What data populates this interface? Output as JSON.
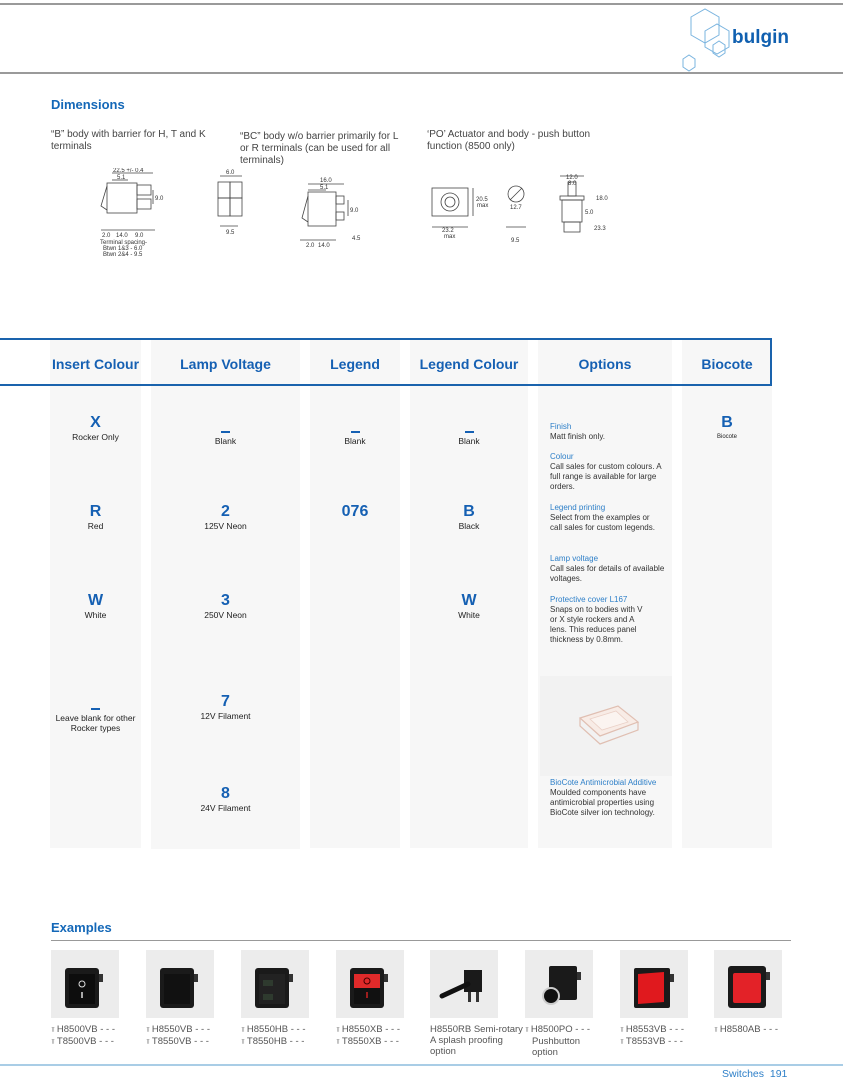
{
  "brand": {
    "name": "bulgin",
    "accent": "#1560b3",
    "light_accent": "#2d7fc8"
  },
  "dimensions": {
    "title": "Dimensions",
    "captions": [
      "“B” body with barrier for H, T and K terminals",
      "“BC” body w/o barrier primarily for L or R terminals (can be used for all terminals)",
      "‘PO’ Actuator and body - push button function (8500 only)"
    ],
    "b_body": {
      "overall": "22.5 +/- 0.4",
      "d1": "5.1",
      "d2": "9.0",
      "bottom": [
        "2.0",
        "14.0",
        "9.0"
      ],
      "spacing_title": "Terminal spacing-",
      "spacing_1": "Btwn 1&3 - 6.0",
      "spacing_2": "Btwn 2&4 - 9.5"
    },
    "end_view": {
      "top": "6.0",
      "bottom": "9.5"
    },
    "bc_body": {
      "overall": "16.0",
      "d1": "5.1",
      "d2": "9.0",
      "d3": "4.5",
      "bottom": [
        "2.0",
        "14.0"
      ]
    },
    "po": {
      "height": "20.5",
      "height_note": "max",
      "width": "23.2",
      "width_note": "max",
      "cutout_dia": "12.7",
      "flat": "9.5",
      "side_top": "12.0",
      "side_top2": "8.0",
      "side_h1": "18.0",
      "side_h2": "5.0",
      "side_h3": "23.3"
    }
  },
  "table": {
    "headers": [
      "Insert Colour",
      "Lamp Voltage",
      "Legend",
      "Legend Colour",
      "Options",
      "Biocote"
    ],
    "insert_colour": [
      {
        "code": "X",
        "desc": "Rocker Only"
      },
      {
        "code": "R",
        "desc": "Red"
      },
      {
        "code": "W",
        "desc": "White"
      },
      {
        "code": "_",
        "desc": "Leave blank for other Rocker types"
      }
    ],
    "lamp_voltage": [
      {
        "code": "_",
        "desc": "Blank"
      },
      {
        "code": "2",
        "desc": "125V Neon"
      },
      {
        "code": "3",
        "desc": "250V Neon"
      },
      {
        "code": "7",
        "desc": "12V Filament"
      },
      {
        "code": "8",
        "desc": "24V Filament"
      }
    ],
    "legend": [
      {
        "code": "_",
        "desc": "Blank"
      },
      {
        "code": "076",
        "desc": ""
      }
    ],
    "legend_colour": [
      {
        "code": "_",
        "desc": "Blank"
      },
      {
        "code": "B",
        "desc": "Black"
      },
      {
        "code": "W",
        "desc": "White"
      }
    ],
    "options": [
      {
        "title": "Finish",
        "body": "Matt finish only."
      },
      {
        "title": "Colour",
        "body": "Call sales for custom colours. A full range is available for large orders."
      },
      {
        "title": "Legend printing",
        "body": "Select from the examples or call sales for custom legends."
      },
      {
        "title": "Lamp voltage",
        "body": "Call sales for details of available voltages."
      },
      {
        "title": "Protective cover L167",
        "body": "Snaps on to bodies with V or X style rockers and A lens. This reduces panel thickness by 0.8mm."
      },
      {
        "title": "BioCote Antimicrobial Additive",
        "body": "Moulded components have antimicrobial properties using BioCote silver ion technology."
      }
    ],
    "biocote": [
      {
        "code": "B",
        "desc": "Biocote"
      }
    ]
  },
  "examples": {
    "title": "Examples",
    "items": [
      {
        "lines": [
          "H8500VB - - -",
          "T8500VB - - -"
        ],
        "pins": true,
        "image": "black-rocker-O-I-icon"
      },
      {
        "lines": [
          "H8550VB - - -",
          "T8550VB - - -"
        ],
        "pins": true,
        "image": "black-rocker-plain-icon"
      },
      {
        "lines": [
          "H8550HB - - -",
          "T8550HB - - -"
        ],
        "pins": true,
        "image": "black-rocker-windows-icon"
      },
      {
        "lines": [
          "H8550XB - - -",
          "T8550XB - - -"
        ],
        "pins": true,
        "image": "red-rocker-O-I-icon"
      },
      {
        "lines": [
          "H8550RB Semi-rotary",
          "A splash proofing",
          "option"
        ],
        "pins": false,
        "image": "semi-rotary-switch-icon"
      },
      {
        "lines": [
          "H8500PO - - -",
          "Pushbutton",
          "option"
        ],
        "pins": true,
        "single_pin": true,
        "image": "pushbutton-switch-icon"
      },
      {
        "lines": [
          "H8553VB - - -",
          "T8553VB - - -"
        ],
        "pins": true,
        "image": "red-illuminated-rocker-icon"
      },
      {
        "lines": [
          "H8580AB - - -"
        ],
        "pins": true,
        "image": "red-lens-indicator-icon"
      }
    ]
  },
  "footer": {
    "section": "Switches",
    "page": "191"
  }
}
